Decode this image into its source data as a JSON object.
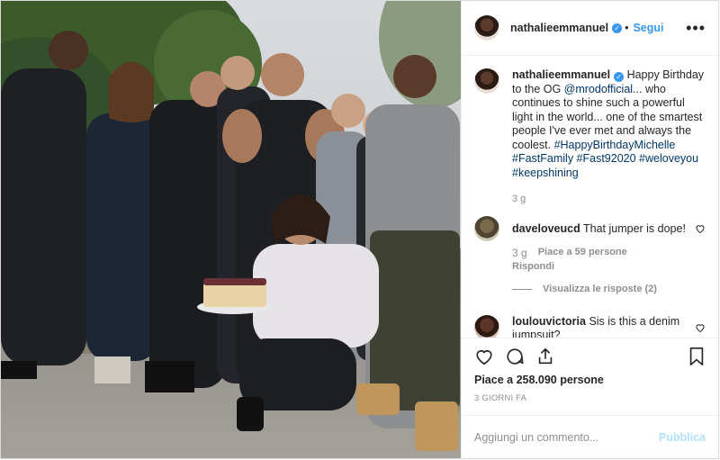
{
  "post": {
    "author": "nathalieemmanuel",
    "follow_label": "Segui",
    "more_label": "•••",
    "separator": "•"
  },
  "caption": {
    "username": "nathalieemmanuel",
    "part1": "Happy Birthday to the OG ",
    "mention": "@mrodofficial",
    "part2": "... who continues to shine such a powerful light in the world... one of the smartest people I've ever met and always the coolest. ",
    "hashtags": "#HappyBirthdayMichelle #FastFamily #Fast92020 #weloveyou #keepshining",
    "age": "3 g"
  },
  "comments": [
    {
      "username": "daveloveucd",
      "text": "That jumper is dope!",
      "age": "3 g",
      "likes": "Piace a 59 persone",
      "reply_label": "Rispondi",
      "view_replies": "Visualizza le risposte (2)"
    },
    {
      "username": "loulouvictoria",
      "text": "Sis is this a denim jumpsuit?"
    }
  ],
  "likes_text": "Piace a 258.090 persone",
  "date_text": "3 GIORNI FA",
  "add_comment": {
    "placeholder": "Aggiungi un commento...",
    "publish_label": "Pubblica"
  },
  "colors": {
    "link": "#00376b",
    "accent": "#3897f0",
    "muted": "#8e8e8e"
  },
  "icons": [
    "verified-badge-icon",
    "heart-icon",
    "comment-icon",
    "share-icon",
    "bookmark-icon"
  ]
}
